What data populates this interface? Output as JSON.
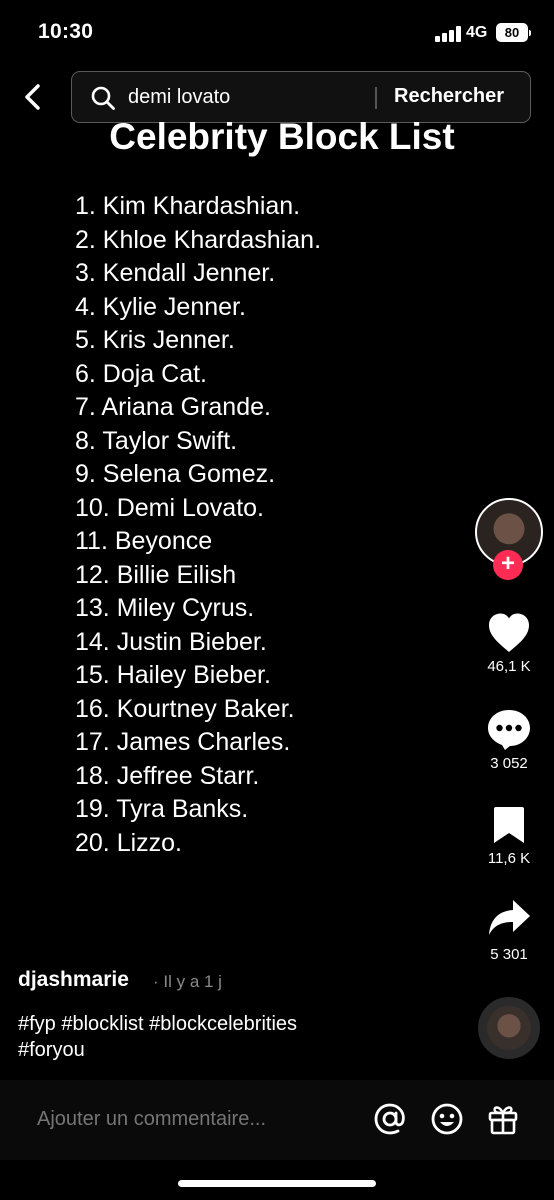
{
  "status_bar": {
    "time": "10:30",
    "network": "4G",
    "battery": "80"
  },
  "search": {
    "query": "demi lovato",
    "submit_label": "Rechercher"
  },
  "video": {
    "title": "Celebrity Block List",
    "list": [
      "1. Kim Khardashian.",
      "2. Khloe Khardashian.",
      "3. Kendall Jenner.",
      "4. Kylie Jenner.",
      "5. Kris Jenner.",
      "6. Doja Cat.",
      "7. Ariana Grande.",
      "8. Taylor Swift.",
      "9. Selena Gomez.",
      "10. Demi Lovato.",
      "11. Beyonce",
      "12. Billie Eilish",
      "13. Miley Cyrus.",
      "14. Justin Bieber.",
      "15. Hailey Bieber.",
      "16. Kourtney Baker.",
      "17. James Charles.",
      "18. Jeffree Starr.",
      "19. Tyra Banks.",
      "20. Lizzo."
    ]
  },
  "rail": {
    "follow_label": "+",
    "likes": "46,1 K",
    "comments": "3 052",
    "saves": "11,6 K",
    "shares": "5 301"
  },
  "post": {
    "username": "djashmarie",
    "time_ago": "· Il y a 1 j",
    "caption_line1": "#fyp #blocklist #blockcelebrities",
    "caption_line2": "#foryou"
  },
  "comment_bar": {
    "placeholder": "Ajouter un commentaire..."
  },
  "colors": {
    "accent": "#fe2c55",
    "background": "#000000"
  }
}
